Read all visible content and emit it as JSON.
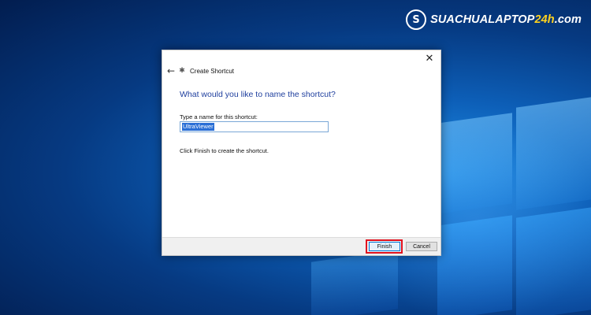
{
  "watermark": {
    "logo_mark": "S",
    "text_main": "SUACHUALAPTOP",
    "text_accent": "24h",
    "text_suffix": ".com"
  },
  "dialog": {
    "title": "Create Shortcut",
    "heading": "What would you like to name the shortcut?",
    "field_label": "Type a name for this shortcut:",
    "field_value": "UltraViewer",
    "hint": "Click Finish to create the shortcut.",
    "finish_label": "Finish",
    "cancel_label": "Cancel",
    "close_glyph": "✕",
    "back_glyph": "←",
    "title_icon_glyph": "✱"
  },
  "icons": {
    "back": "back-arrow-icon",
    "close": "close-icon",
    "title": "shortcut-wizard-icon"
  },
  "colors": {
    "heading": "#1f3f9e",
    "highlight_box": "#e1121f",
    "selection": "#2a6fd6"
  }
}
